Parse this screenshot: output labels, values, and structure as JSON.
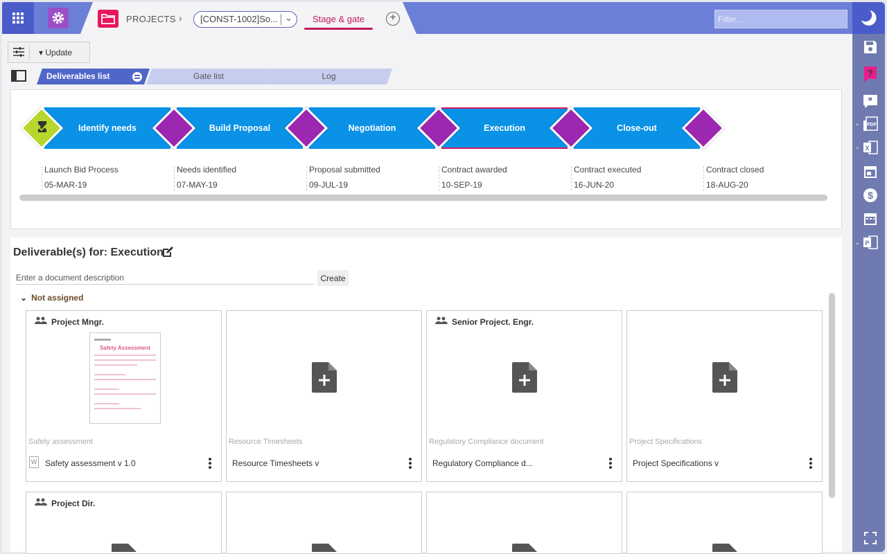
{
  "topbar": {
    "projects_label": "PROJECTS",
    "project_select": "[CONST-1002]So...",
    "active_tab": "Stage & gate",
    "filter_placeholder": "Filter..."
  },
  "toolbar": {
    "update_label": "Update"
  },
  "tabs": [
    {
      "label": "Deliverables list"
    },
    {
      "label": "Gate list"
    },
    {
      "label": "Log"
    }
  ],
  "stages": [
    {
      "label": "Identify needs"
    },
    {
      "label": "Build Proposal"
    },
    {
      "label": "Negotiation"
    },
    {
      "label": "Execution"
    },
    {
      "label": "Close-out"
    }
  ],
  "gates": [
    {
      "label": "Launch Bid Process",
      "date": "05-MAR-19"
    },
    {
      "label": "Needs identified",
      "date": "07-MAY-19"
    },
    {
      "label": "Proposal submitted",
      "date": "09-JUL-19"
    },
    {
      "label": "Contract awarded",
      "date": "10-SEP-19"
    },
    {
      "label": "Contract executed",
      "date": "16-JUN-20"
    },
    {
      "label": "Contract closed",
      "date": "18-AUG-20"
    }
  ],
  "deliverables": {
    "title": "Deliverable(s) for: Execution",
    "input_placeholder": "Enter a document description",
    "create_label": "Create",
    "group_label": "Not assigned",
    "cards": [
      {
        "owner": "Project Mngr.",
        "category": "Safety assessment",
        "doc": "Safety assessment v 1.0",
        "thumb_title": "Safety Assessment"
      },
      {
        "owner": "",
        "category": "Resource Timesheets",
        "doc": "Resource Timesheets v"
      },
      {
        "owner": "Senior Project. Engr.",
        "category": "Regulatory Compliance document",
        "doc": "Regulatory Compliance d..."
      },
      {
        "owner": "",
        "category": "Project Specifications",
        "doc": "Project Specifications v"
      },
      {
        "owner": "Project Dir."
      }
    ]
  }
}
